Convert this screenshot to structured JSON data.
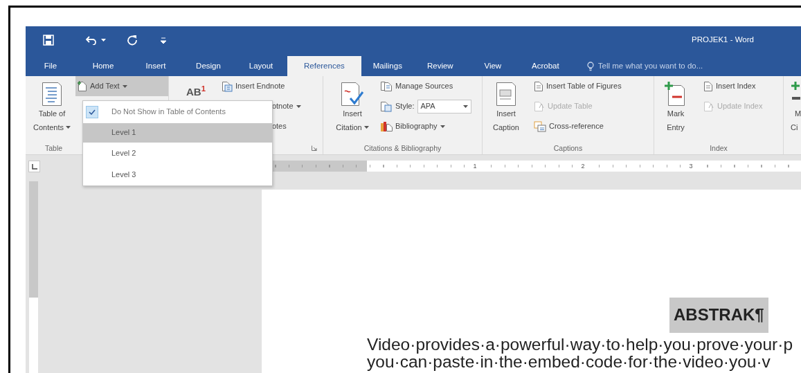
{
  "window": {
    "title": "PROJEK1 - Word"
  },
  "tabs": [
    {
      "label": "File",
      "selected": false
    },
    {
      "label": "Home",
      "selected": false
    },
    {
      "label": "Insert",
      "selected": false
    },
    {
      "label": "Design",
      "selected": false
    },
    {
      "label": "Layout",
      "selected": false
    },
    {
      "label": "References",
      "selected": true
    },
    {
      "label": "Mailings",
      "selected": false
    },
    {
      "label": "Review",
      "selected": false
    },
    {
      "label": "View",
      "selected": false
    },
    {
      "label": "Acrobat",
      "selected": false
    }
  ],
  "tell_me": {
    "placeholder": "Tell me what you want to do..."
  },
  "ribbon": {
    "groups": [
      {
        "label": "Table",
        "launcher": false,
        "controls": [
          {
            "kind": "large",
            "lines": [
              "Table of",
              "Contents"
            ],
            "dropdown": true
          },
          {
            "kind": "small",
            "label": "Add Text",
            "dropdown": true,
            "pressed": true,
            "disabled": false
          }
        ]
      },
      {
        "launcher": true,
        "controls": [
          {
            "kind": "glyph",
            "label": "AB$^{1}$"
          },
          {
            "kind": "small",
            "label": "Insert Endnote",
            "dropdown": false,
            "pressed": false,
            "disabled": false
          },
          {
            "kind": "small",
            "label": "otnote",
            "dropdown": true,
            "pressed": false,
            "disabled": false
          },
          {
            "kind": "small",
            "label": "otes",
            "dropdown": false,
            "pressed": false,
            "disabled": false
          }
        ]
      },
      {
        "label": "Citations & Bibliography",
        "launcher": false,
        "controls": [
          {
            "kind": "large",
            "lines": [
              "Insert",
              "Citation"
            ],
            "dropdown": true
          },
          {
            "kind": "small",
            "label": "Manage Sources",
            "dropdown": false,
            "pressed": false,
            "disabled": false
          },
          {
            "kind": "combo",
            "label": "Style:",
            "value": "APA"
          },
          {
            "kind": "small",
            "label": "Bibliography",
            "dropdown": true,
            "pressed": false,
            "disabled": false
          }
        ]
      },
      {
        "label": "Captions",
        "launcher": false,
        "controls": [
          {
            "kind": "large",
            "lines": [
              "Insert",
              "Caption"
            ],
            "dropdown": false
          },
          {
            "kind": "small",
            "label": "Insert Table of Figures",
            "dropdown": false,
            "pressed": false,
            "disabled": false
          },
          {
            "kind": "small",
            "label": "Update Table",
            "dropdown": false,
            "pressed": false,
            "disabled": true
          },
          {
            "kind": "small",
            "label": "Cross-reference",
            "dropdown": false,
            "pressed": false,
            "disabled": false
          }
        ]
      },
      {
        "label": "Index",
        "launcher": false,
        "controls": [
          {
            "kind": "large",
            "lines": [
              "Mark",
              "Entry"
            ],
            "dropdown": false
          },
          {
            "kind": "small",
            "label": "Insert Index",
            "dropdown": false,
            "pressed": false,
            "disabled": false
          },
          {
            "kind": "small",
            "label": "Update Index",
            "dropdown": false,
            "pressed": false,
            "disabled": true
          }
        ]
      },
      {
        "launcher": false,
        "controls": [
          {
            "kind": "large",
            "lines": [
              "M",
              "Ci"
            ],
            "dropdown": false
          }
        ]
      }
    ]
  },
  "menu": {
    "items": [
      {
        "label": "Do Not Show in Table of Contents",
        "checked": true,
        "selected": false
      },
      {
        "label": "Level 1",
        "checked": false,
        "selected": true
      },
      {
        "label": "Level 2",
        "checked": false,
        "selected": false
      },
      {
        "label": "Level 3",
        "checked": false,
        "selected": false
      }
    ]
  },
  "ruler": {
    "numbers": [
      "1",
      "2",
      "3"
    ]
  },
  "document": {
    "heading": "ABSTRAK¶",
    "heading_highlighted": true,
    "lines": [
      "Video·provides·a·powerful·way·to·help·you·prove·your·p",
      "you·can·paste·in·the·embed·code·for·the·video·you·v"
    ]
  }
}
